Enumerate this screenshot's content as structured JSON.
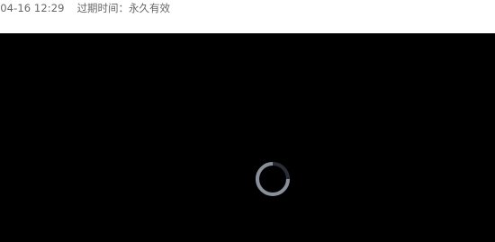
{
  "header": {
    "date_text": "-04-16 12:29",
    "expire_text": "过期时间：永久有效"
  },
  "player": {
    "status": "loading",
    "spinner_icon": "loading-spinner-icon",
    "background_color": "#000000",
    "spinner_color": "#8a8f9c"
  }
}
